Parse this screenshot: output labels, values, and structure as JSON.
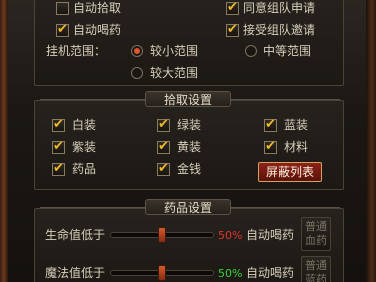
{
  "options": {
    "auto_pickup": {
      "label": "自动拾取",
      "checked": false
    },
    "agree_team_request": {
      "label": "同意组队申请",
      "checked": true
    },
    "auto_drink": {
      "label": "自动喝药",
      "checked": true
    },
    "accept_team_invite": {
      "label": "接受组队邀请",
      "checked": true
    },
    "range_label": "挂机范围：",
    "range_options": [
      {
        "label": "较小范围",
        "selected": true
      },
      {
        "label": "中等范围",
        "selected": false
      },
      {
        "label": "较大范围",
        "selected": false
      }
    ]
  },
  "pickup": {
    "title": "拾取设置",
    "items": [
      {
        "label": "白装",
        "checked": true
      },
      {
        "label": "绿装",
        "checked": true
      },
      {
        "label": "蓝装",
        "checked": true
      },
      {
        "label": "紫装",
        "checked": true
      },
      {
        "label": "黄装",
        "checked": true
      },
      {
        "label": "材料",
        "checked": true
      },
      {
        "label": "药品",
        "checked": true
      },
      {
        "label": "金钱",
        "checked": true
      }
    ],
    "block_list_button": "屏蔽列表"
  },
  "drug": {
    "title": "药品设置",
    "hp": {
      "label": "生命值低于",
      "percent": "50%",
      "value": 0.5,
      "action": "自动喝药",
      "button": [
        "普通",
        "血药"
      ]
    },
    "mp": {
      "label": "魔法值低于",
      "percent": "50%",
      "value": 0.5,
      "action": "自动喝药",
      "button": [
        "普通",
        "蓝药"
      ]
    }
  },
  "colors": {
    "hp_percent": "#e0342a",
    "mp_percent": "#38d23a",
    "checkmark": "#f0b92a"
  }
}
